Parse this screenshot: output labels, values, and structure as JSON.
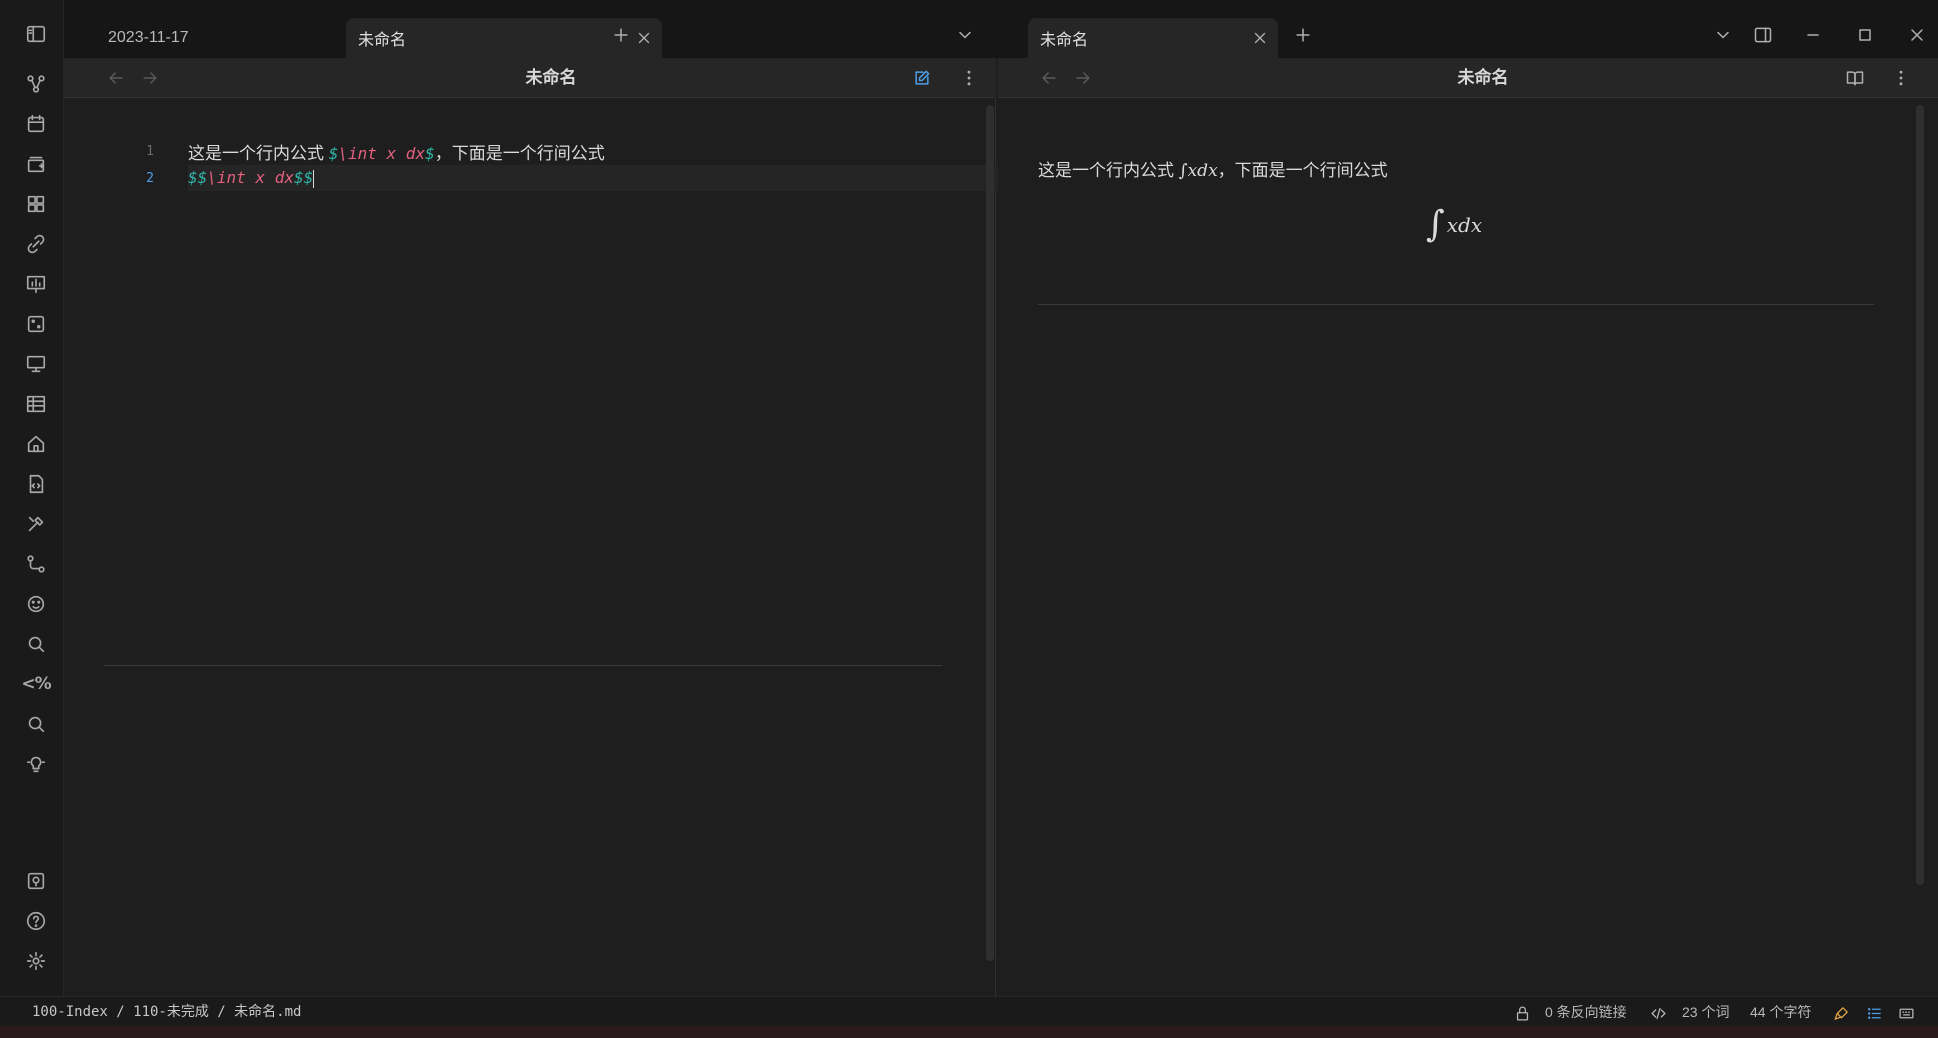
{
  "tabs_left": [
    {
      "label": "2023-11-17",
      "active": false
    },
    {
      "label": "未命名",
      "active": true
    }
  ],
  "tabs_right": [
    {
      "label": "未命名",
      "active": true
    }
  ],
  "left_view": {
    "title": "未命名"
  },
  "right_view": {
    "title": "未命名"
  },
  "editor": {
    "line1_no": "1",
    "line1_prefix": "这是一个行内公式 ",
    "line1_dollar_open": "$",
    "line1_math": "\\int x dx",
    "line1_dollar_close": "$",
    "line1_suffix": "，下面是一个行间公式",
    "line2_no": "2",
    "line2_dollar_open": "$$",
    "line2_math": "\\int x dx",
    "line2_dollar_close": "$$"
  },
  "preview": {
    "text_prefix": "这是一个行内公式 ",
    "inline_integral": "∫",
    "inline_math": "xdx",
    "text_suffix": "，下面是一个行间公式",
    "display_integral": "∫",
    "display_math": "xdx"
  },
  "statusbar": {
    "breadcrumb": "100-Index / 110-未完成 / 未命名.md",
    "backlinks": "0 条反向链接",
    "words": "23 个词",
    "chars": "44 个字符"
  },
  "ribbon_icons": [
    "sidebar-toggle-icon",
    "graph-icon",
    "calendar-icon",
    "canvas-icon",
    "dashboard-icon",
    "link-icon",
    "slides-icon",
    "dice-icon",
    "monitor-icon",
    "table-icon",
    "home-icon",
    "code-file-icon",
    "tools-icon",
    "workflow-icon",
    "emoji-icon",
    "search-icon",
    "templater-icon",
    "search-icon",
    "lightbulb-icon",
    "vault-icon",
    "help-icon",
    "settings-icon"
  ],
  "ribbon_templater_label": "<%"
}
